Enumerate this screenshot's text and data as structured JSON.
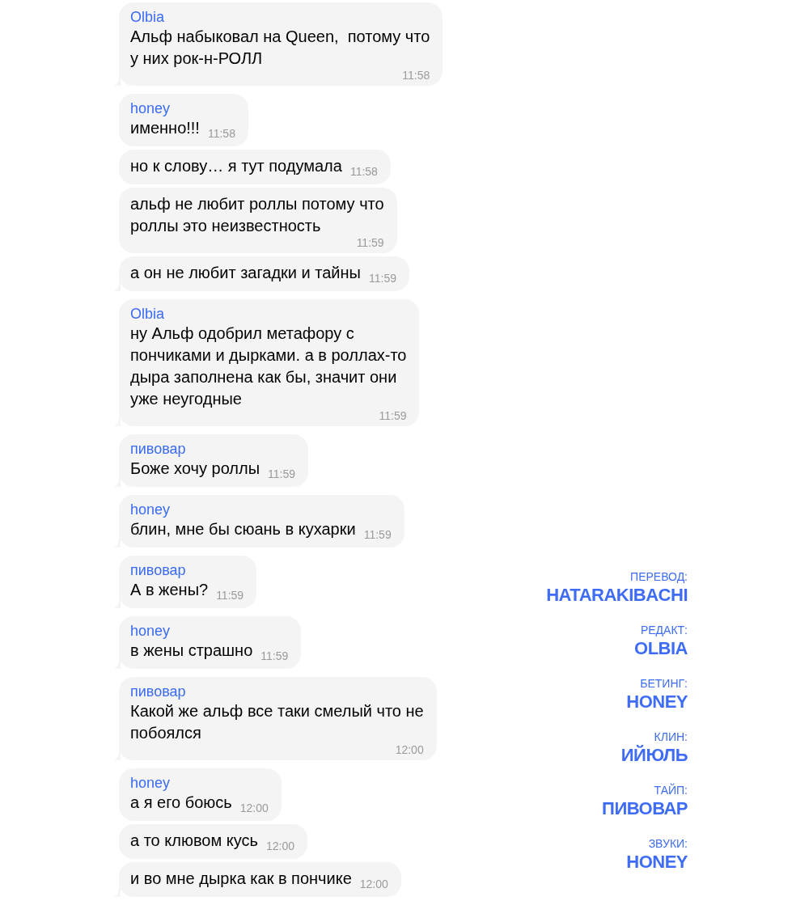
{
  "chat": {
    "groups": [
      {
        "sender": "Olbia",
        "messages": [
          {
            "text": "Альф набыковал на Queen,  потому что\nу них рок-н-РОЛЛ",
            "time": "11:58"
          }
        ]
      },
      {
        "sender": "honey",
        "messages": [
          {
            "text": "именно!!!",
            "time": "11:58"
          },
          {
            "text": "но к слову… я тут подумала",
            "time": "11:58"
          },
          {
            "text": "альф не любит роллы потому что\nроллы это неизвестность",
            "time": "11:59"
          },
          {
            "text": "а он не любит загадки и тайны",
            "time": "11:59"
          }
        ]
      },
      {
        "sender": "Olbia",
        "messages": [
          {
            "text": "ну Альф одобрил метафору с\nпончиками и дырками. а в роллах-то\nдыра заполнена как бы, значит они\nуже неугодные",
            "time": "11:59"
          }
        ]
      },
      {
        "sender": "пивовар",
        "messages": [
          {
            "text": "Боже хочу роллы",
            "time": "11:59"
          }
        ]
      },
      {
        "sender": "honey",
        "messages": [
          {
            "text": "блин, мне бы сюань в кухарки",
            "time": "11:59"
          }
        ]
      },
      {
        "sender": "пивовар",
        "messages": [
          {
            "text": "А в жены?",
            "time": "11:59"
          }
        ]
      },
      {
        "sender": "honey",
        "messages": [
          {
            "text": "в жены страшно",
            "time": "11:59"
          }
        ]
      },
      {
        "sender": "пивовар",
        "messages": [
          {
            "text": "Какой же альф все таки смелый что не\nпобоялся",
            "time": "12:00"
          }
        ]
      },
      {
        "sender": "honey",
        "messages": [
          {
            "text": "а я его боюсь",
            "time": "12:00"
          },
          {
            "text": "а то клювом кусь",
            "time": "12:00"
          },
          {
            "text": "и во мне дырка как в пончике",
            "time": "12:00"
          }
        ]
      }
    ]
  },
  "credits": [
    {
      "role": "ПЕРЕВОД:",
      "name": "HATARAKIBACHI"
    },
    {
      "role": "РЕДАКТ:",
      "name": "OLBIA"
    },
    {
      "role": "БЕТИНГ:",
      "name": "HONEY"
    },
    {
      "role": "КЛИН:",
      "name": "ИЙЮЛЬ"
    },
    {
      "role": "ТАЙП:",
      "name": "ПИВОВАР"
    },
    {
      "role": "ЗВУКИ:",
      "name": "HONEY"
    }
  ]
}
